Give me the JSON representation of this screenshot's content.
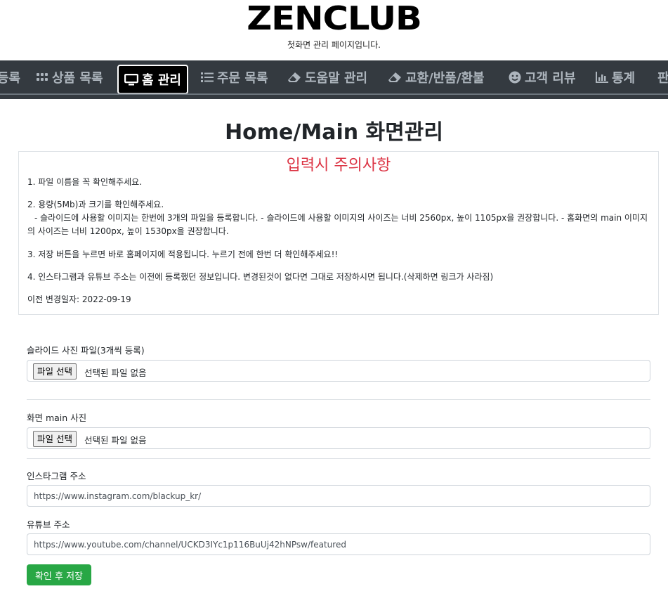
{
  "brand": {
    "logo": "ZENCLUB",
    "subtitle": "첫화면 관리 페이지입니다."
  },
  "nav": {
    "items": [
      {
        "label": "등록",
        "icon": "none"
      },
      {
        "label": "상품 목록",
        "icon": "grid-icon"
      },
      {
        "label": "홈 관리",
        "icon": "monitor-icon",
        "active": true
      },
      {
        "label": "주문 목록",
        "icon": "list-icon"
      },
      {
        "label": "도움말 관리",
        "icon": "eraser-icon"
      },
      {
        "label": "교환/반품/환불",
        "icon": "eraser-icon"
      },
      {
        "label": "고객 리뷰",
        "icon": "smile-icon"
      },
      {
        "label": "통계",
        "icon": "chart-icon"
      },
      {
        "label": "판",
        "icon": "none"
      }
    ]
  },
  "page": {
    "title": "Home/Main 화면관리"
  },
  "notice": {
    "title": "입력시 주의사항",
    "line1": "1. 파일 이름을 꼭 확인해주세요.",
    "line2": "2. 용량(5Mb)과 크기를 확인해주세요.",
    "line2_detail": "- 슬라이드에 사용할 이미지는 한번에 3개의 파일을 등록합니다.   - 슬라이드에 사용할 이미지의 사이즈는 너비 2560px, 높이 1105px을 권장합니다.   - 홈화면의 main 이미지의 사이즈는 너비 1200px, 높이 1530px을 권장합니다.",
    "line3": "3. 저장 버튼을 누르면 바로 홈페이지에 적용됩니다. 누르기 전에 한번 더 확인해주세요!!",
    "line4": "4. 인스타그램과 유튜브 주소는 이전에 등록했던 정보입니다. 변경된것이 없다면 그대로 저장하시면 됩니다.(삭제하면 링크가 사라짐)",
    "last_modified": "이전 변경일자: 2022-09-19"
  },
  "form": {
    "slide_label": "슬라이드 사진 파일(3개씩 등록)",
    "main_label": "화면 main 사진",
    "file_button": "파일 선택",
    "no_file": "선택된 파일 없음",
    "instagram_label": "인스타그램 주소",
    "instagram_value": "https://www.instagram.com/blackup_kr/",
    "youtube_label": "유튜브 주소",
    "youtube_value": "https://www.youtube.com/channel/UCKD3IYc1p116BuUj42hNPsw/featured",
    "save_button": "확인 후 저장"
  }
}
